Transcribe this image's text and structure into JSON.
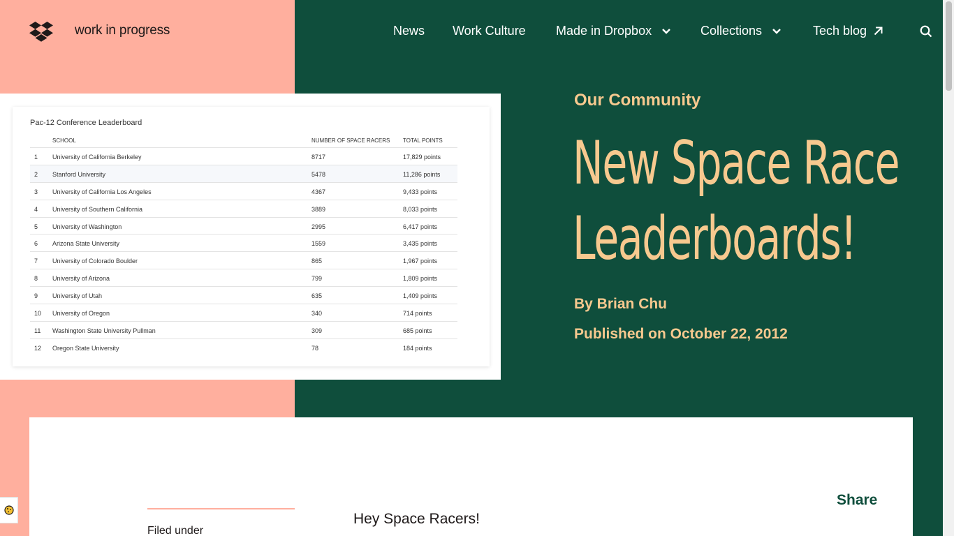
{
  "header": {
    "logo_text": "work in progress",
    "nav": [
      {
        "label": "News",
        "has_dropdown": false
      },
      {
        "label": "Work Culture",
        "has_dropdown": false
      },
      {
        "label": "Made in Dropbox",
        "has_dropdown": true
      },
      {
        "label": "Collections",
        "has_dropdown": true
      },
      {
        "label": "Tech blog",
        "has_external": true
      }
    ],
    "search_icon": "search-icon"
  },
  "hero": {
    "category": "Our Community",
    "title_line1": "New Space Race",
    "title_line2": "Leaderboards!",
    "byline": "By Brian Chu",
    "published": "Published on October 22, 2012"
  },
  "leaderboard": {
    "title": "Pac-12 Conference Leaderboard",
    "columns": [
      "SCHOOL",
      "NUMBER OF SPACE RACERS",
      "TOTAL POINTS"
    ],
    "rows": [
      {
        "rank": "1",
        "school": "University of California Berkeley",
        "racers": "8717",
        "points": "17,829 points"
      },
      {
        "rank": "2",
        "school": "Stanford University",
        "racers": "5478",
        "points": "11,286 points"
      },
      {
        "rank": "3",
        "school": "University of California Los Angeles",
        "racers": "4367",
        "points": "9,433 points"
      },
      {
        "rank": "4",
        "school": "University of Southern California",
        "racers": "3889",
        "points": "8,033 points"
      },
      {
        "rank": "5",
        "school": "University of Washington",
        "racers": "2995",
        "points": "6,417 points"
      },
      {
        "rank": "6",
        "school": "Arizona State University",
        "racers": "1559",
        "points": "3,435 points"
      },
      {
        "rank": "7",
        "school": "University of Colorado Boulder",
        "racers": "865",
        "points": "1,967 points"
      },
      {
        "rank": "8",
        "school": "University of Arizona",
        "racers": "799",
        "points": "1,809 points"
      },
      {
        "rank": "9",
        "school": "University of Utah",
        "racers": "635",
        "points": "1,409 points"
      },
      {
        "rank": "10",
        "school": "University of Oregon",
        "racers": "340",
        "points": "714 points"
      },
      {
        "rank": "11",
        "school": "Washington State University Pullman",
        "racers": "309",
        "points": "685 points"
      },
      {
        "rank": "12",
        "school": "Oregon State University",
        "racers": "78",
        "points": "184 points"
      }
    ]
  },
  "article": {
    "filed_under": "Filed under",
    "intro": "Hey Space Racers!",
    "share": "Share"
  },
  "colors": {
    "pink": "#ffaf9e",
    "green": "#0f4e3c",
    "gold": "#f7c98f"
  }
}
